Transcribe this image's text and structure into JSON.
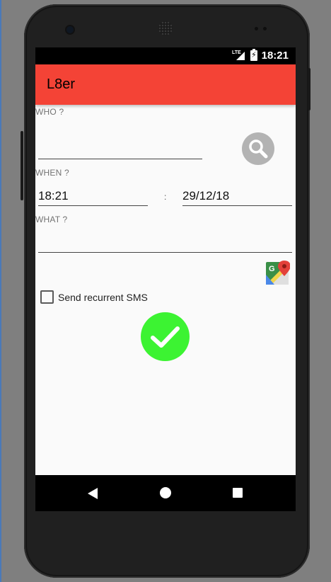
{
  "status_bar": {
    "network": "LTE",
    "time": "18:21",
    "signal_icon": "signal-icon",
    "battery_icon": "battery-charging-icon"
  },
  "app_bar": {
    "title": "L8er",
    "color": "#f44336"
  },
  "form": {
    "who_label": "WHO ?",
    "who_value": "",
    "search_icon": "search-icon",
    "when_label": "WHEN ?",
    "time_value": "18:21",
    "separator": ":",
    "date_value": "29/12/18",
    "what_label": "WHAT ?",
    "what_value": "",
    "maps_icon": "google-maps-icon",
    "recurrent_label": "Send recurrent SMS",
    "recurrent_checked": false,
    "confirm_icon": "checkmark-icon",
    "confirm_color": "#3cf332"
  },
  "nav_bar": {
    "back_icon": "back-icon",
    "home_icon": "home-icon",
    "recents_icon": "recents-icon"
  }
}
